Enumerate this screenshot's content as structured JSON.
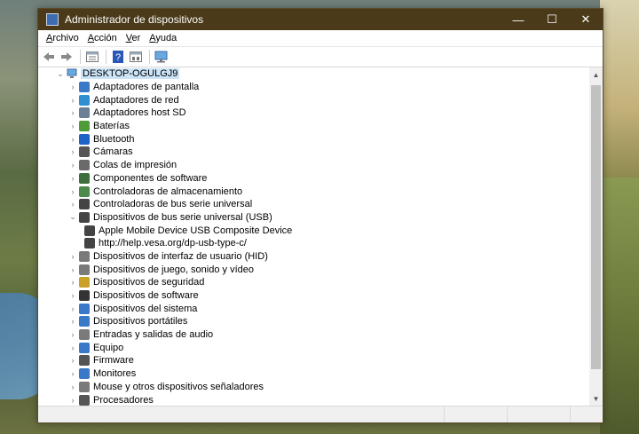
{
  "window": {
    "title": "Administrador de dispositivos"
  },
  "controls": {
    "minimize": "—",
    "maximize": "☐",
    "close": "✕"
  },
  "menu": [
    {
      "hot": "A",
      "rest": "rchivo"
    },
    {
      "hot": "A",
      "rest": "cción"
    },
    {
      "hot": "V",
      "rest": "er"
    },
    {
      "hot": "A",
      "rest": "yuda"
    }
  ],
  "tree": {
    "root": "DESKTOP-OGULGJ9",
    "items": [
      {
        "label": "Adaptadores de pantalla",
        "icon": "display-adapter-icon",
        "color": "#3a78c8"
      },
      {
        "label": "Adaptadores de red",
        "icon": "network-adapter-icon",
        "color": "#2f8fd1"
      },
      {
        "label": "Adaptadores host SD",
        "icon": "sd-host-icon",
        "color": "#6b7f95"
      },
      {
        "label": "Baterías",
        "icon": "battery-icon",
        "color": "#4f9a3a"
      },
      {
        "label": "Bluetooth",
        "icon": "bluetooth-icon",
        "color": "#1e63c6"
      },
      {
        "label": "Cámaras",
        "icon": "camera-icon",
        "color": "#555555"
      },
      {
        "label": "Colas de impresión",
        "icon": "printer-icon",
        "color": "#6a6a6a"
      },
      {
        "label": "Componentes de software",
        "icon": "software-component-icon",
        "color": "#3f6f3f"
      },
      {
        "label": "Controladoras de almacenamiento",
        "icon": "storage-controller-icon",
        "color": "#4a8a4a"
      },
      {
        "label": "Controladoras de bus serie universal",
        "icon": "usb-controller-icon",
        "color": "#444444"
      },
      {
        "label": "Dispositivos de bus serie universal (USB)",
        "icon": "usb-device-icon",
        "color": "#444444",
        "expanded": true,
        "children": [
          {
            "label": "Apple Mobile Device USB Composite Device",
            "icon": "usb-plug-icon",
            "color": "#444444"
          },
          {
            "label": "http://help.vesa.org/dp-usb-type-c/",
            "icon": "usb-plug-icon",
            "color": "#444444"
          }
        ]
      },
      {
        "label": "Dispositivos de interfaz de usuario (HID)",
        "icon": "hid-icon",
        "color": "#7a7a7a"
      },
      {
        "label": "Dispositivos de juego, sonido y vídeo",
        "icon": "sound-icon",
        "color": "#7a7a7a"
      },
      {
        "label": "Dispositivos de seguridad",
        "icon": "security-key-icon",
        "color": "#c9a227"
      },
      {
        "label": "Dispositivos de software",
        "icon": "software-device-icon",
        "color": "#333333"
      },
      {
        "label": "Dispositivos del sistema",
        "icon": "system-device-icon",
        "color": "#3a78c8"
      },
      {
        "label": "Dispositivos portátiles",
        "icon": "portable-device-icon",
        "color": "#3a78c8"
      },
      {
        "label": "Entradas y salidas de audio",
        "icon": "audio-io-icon",
        "color": "#7a7a7a"
      },
      {
        "label": "Equipo",
        "icon": "computer-icon",
        "color": "#3a78c8"
      },
      {
        "label": "Firmware",
        "icon": "firmware-icon",
        "color": "#555555"
      },
      {
        "label": "Monitores",
        "icon": "monitor-icon",
        "color": "#3a78c8"
      },
      {
        "label": "Mouse y otros dispositivos señaladores",
        "icon": "mouse-icon",
        "color": "#7a7a7a"
      },
      {
        "label": "Procesadores",
        "icon": "processor-icon",
        "color": "#555555"
      }
    ]
  }
}
